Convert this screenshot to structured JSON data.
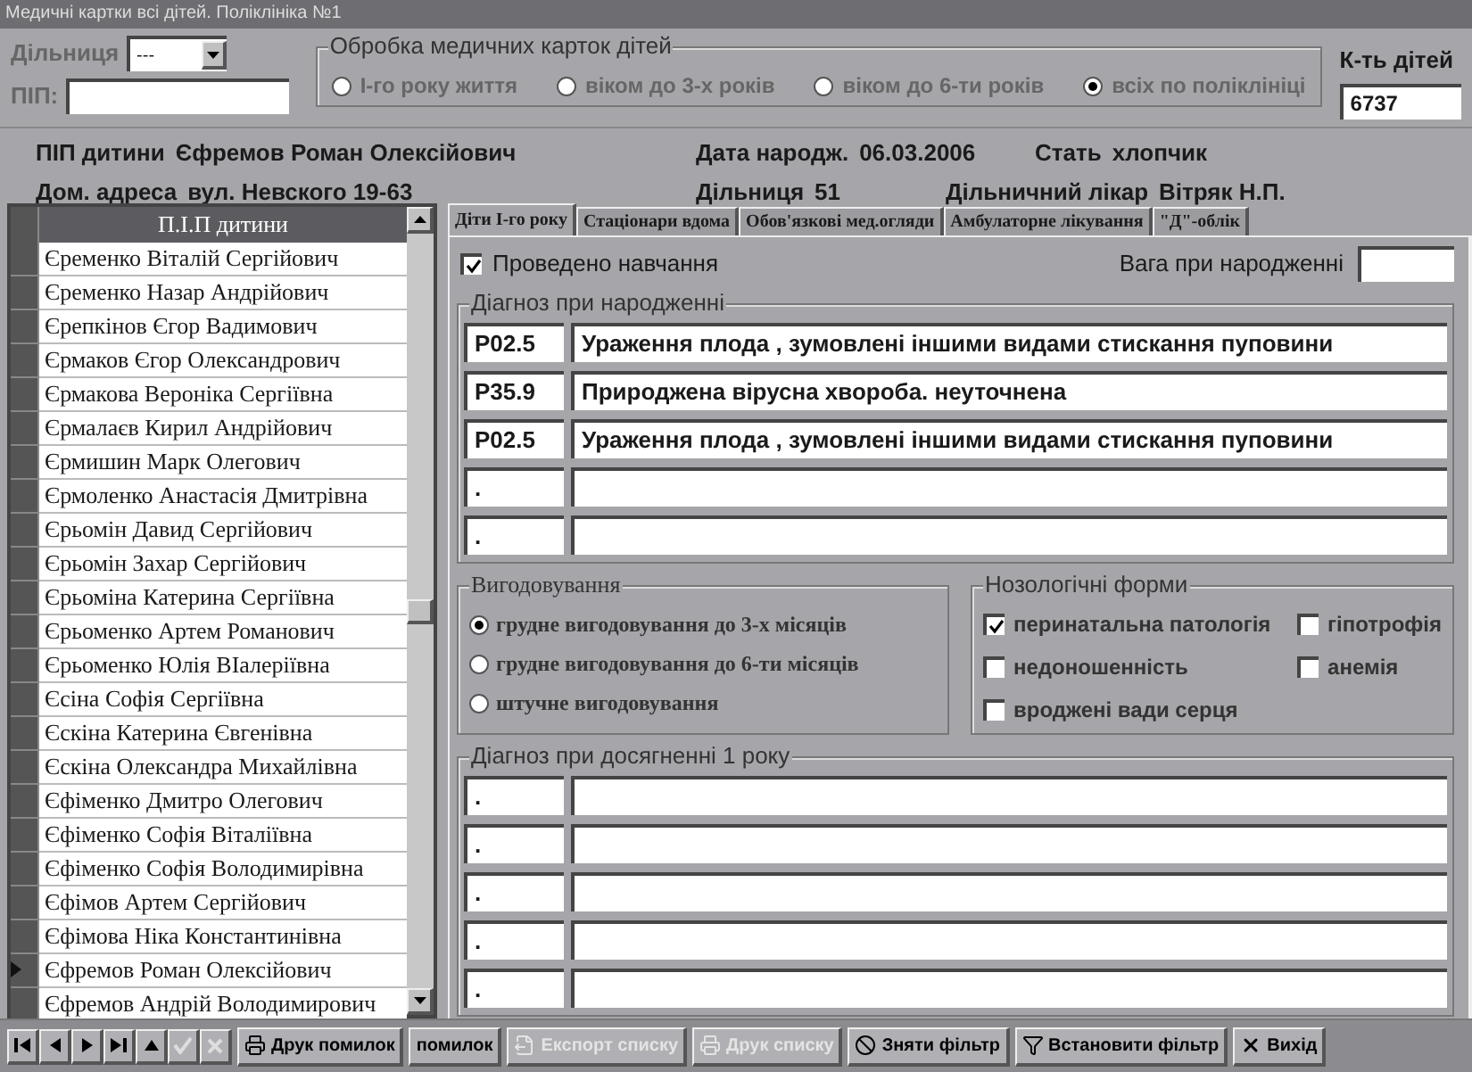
{
  "window": {
    "title": "Медичні картки всі дітей. Поліклініка №1"
  },
  "filter": {
    "district_label": "Дільниця",
    "district_value": "---",
    "pib_label": "ПІП:",
    "group_title": "Обробка медичних карток дітей",
    "radios": [
      {
        "label": "I-го року життя",
        "selected": false
      },
      {
        "label": "віком до 3-х років",
        "selected": false
      },
      {
        "label": "віком до 6-ти років",
        "selected": false
      },
      {
        "label": "всіх по поліклініці",
        "selected": true
      }
    ],
    "count_label": "К-ть дітей",
    "count_value": "6737"
  },
  "patient": {
    "line1": [
      {
        "label": "ПІП дитини",
        "value": "Єфремов  Роман  Олексійович"
      },
      {
        "label": "Дата народж.",
        "value": "06.03.2006"
      },
      {
        "label": "Стать",
        "value": "хлопчик"
      }
    ],
    "line2": [
      {
        "label": "Дом. адреса",
        "value": "вул. Невского 19-63"
      },
      {
        "label": "Дільниця",
        "value": "51"
      },
      {
        "label": "Дільничний лікар",
        "value": "Вітряк Н.П."
      }
    ]
  },
  "list": {
    "header": "П.І.П дитини",
    "rows": [
      {
        "name": "Єременко Віталій Сергійович",
        "selected": false
      },
      {
        "name": "Єременко Назар Андрійович",
        "selected": false
      },
      {
        "name": "Єрепкінов Єгор Вадимович",
        "selected": false
      },
      {
        "name": "Єрмаков Єгор Олександрович",
        "selected": false
      },
      {
        "name": "Єрмакова Вероніка Сергіївна",
        "selected": false
      },
      {
        "name": "Єрмалаєв Кирил Андрійович",
        "selected": false
      },
      {
        "name": "Єрмишин  Марк Олегович",
        "selected": false
      },
      {
        "name": "Єрмоленко Анастасія Дмитрівна",
        "selected": false
      },
      {
        "name": "Єрьомін Давид Сергійович",
        "selected": false
      },
      {
        "name": "Єрьомін Захар Сергійович",
        "selected": false
      },
      {
        "name": "Єрьоміна Катерина Сергіївна",
        "selected": false
      },
      {
        "name": "Єрьоменко Артем Романович",
        "selected": false
      },
      {
        "name": "Єрьоменко Юлія ВІалеріївна",
        "selected": false
      },
      {
        "name": "Єсіна Софія Сергіївна",
        "selected": false
      },
      {
        "name": "Єскіна Катерина Євгенівна",
        "selected": false
      },
      {
        "name": "Єскіна Олександра Михайлівна",
        "selected": false
      },
      {
        "name": "Єфіменко Дмитро Олегович",
        "selected": false
      },
      {
        "name": "Єфіменко Софія Віталіївна",
        "selected": false
      },
      {
        "name": "Єфіменко Софія Володимирівна",
        "selected": false
      },
      {
        "name": "Єфімов Артем Сергійович",
        "selected": false
      },
      {
        "name": "Єфімова Ніка Константинівна",
        "selected": false
      },
      {
        "name": "Єфремов  Роман  Олексійович",
        "selected": true
      },
      {
        "name": "Єфремов Андрій Володимирович",
        "selected": false
      }
    ]
  },
  "tabs": [
    {
      "label": "Діти I-го року",
      "selected": true
    },
    {
      "label": "Стаціонари вдома",
      "selected": false
    },
    {
      "label": "Обов'язкові мед.огляди",
      "selected": false
    },
    {
      "label": "Амбулаторне лікування",
      "selected": false
    },
    {
      "label": "\"Д\"-облік",
      "selected": false
    }
  ],
  "training": {
    "label": "Проведено навчання",
    "checked": true
  },
  "weight_label": "Вага при народженні",
  "birth_diagnoses": {
    "title": "Діагноз при народженні",
    "rows": [
      {
        "code": "P02.5",
        "text": "Ураження плода , зумовлені іншими видами стискання пуповини"
      },
      {
        "code": "P35.9",
        "text": "Природжена вірусна хвороба. неуточнена"
      },
      {
        "code": "P02.5",
        "text": "Ураження плода , зумовлені іншими видами стискання пуповини"
      },
      {
        "code": "."
      },
      {
        "code": "."
      }
    ]
  },
  "feeding": {
    "title": "Вигодовування",
    "options": [
      {
        "label": "грудне вигодовування до 3-х місяців",
        "selected": true
      },
      {
        "label": "грудне вигодовування до 6-ти місяців",
        "selected": false
      },
      {
        "label": "штучне вигодовування",
        "selected": false
      }
    ]
  },
  "nosology": {
    "title": "Нозологічні форми",
    "items": [
      {
        "label": "перинатальна патологія",
        "checked": true
      },
      {
        "label": "гіпотрофія",
        "checked": false
      },
      {
        "label": "недоношенність",
        "checked": false
      },
      {
        "label": "анемія",
        "checked": false
      },
      {
        "label": "вроджені вади серця",
        "checked": false
      }
    ]
  },
  "year_diagnoses": {
    "title": "Діагноз при досягненні 1 року",
    "rows": [
      {
        "code": "."
      },
      {
        "code": "."
      },
      {
        "code": "."
      },
      {
        "code": "."
      },
      {
        "code": "."
      }
    ]
  },
  "toolbar": {
    "nav": [
      {
        "kind": "first",
        "disabled": false
      },
      {
        "kind": "prev",
        "disabled": false
      },
      {
        "kind": "next",
        "disabled": false
      },
      {
        "kind": "last",
        "disabled": false
      },
      {
        "kind": "up",
        "disabled": false
      },
      {
        "kind": "check",
        "disabled": true
      },
      {
        "kind": "cancel",
        "disabled": true
      }
    ],
    "buttons": [
      {
        "label": "Друк помилок",
        "kind": "printer",
        "disabled": false
      },
      {
        "label": "помилок",
        "kind": "text",
        "disabled": false
      },
      {
        "label": "Експорт списку",
        "kind": "export",
        "disabled": true
      },
      {
        "label": "Друк списку",
        "kind": "printer",
        "disabled": true
      },
      {
        "label": "Зняти фільтр",
        "kind": "ban",
        "disabled": false
      },
      {
        "label": "Встановити фільтр",
        "kind": "filter",
        "disabled": false
      },
      {
        "label": "Вихід",
        "kind": "close",
        "disabled": false
      }
    ]
  }
}
